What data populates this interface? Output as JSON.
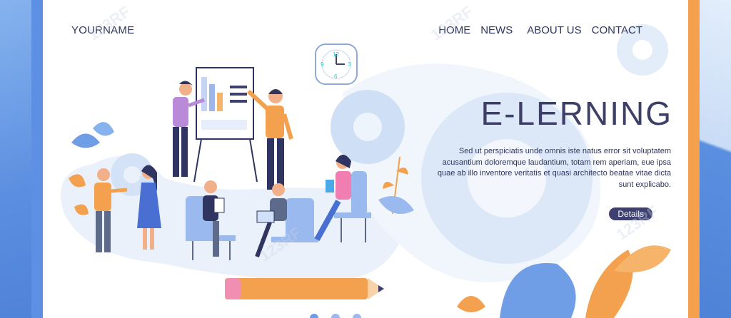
{
  "header": {
    "brand": "YOURNAME",
    "nav": [
      {
        "label": "HOME"
      },
      {
        "label": "NEWS"
      },
      {
        "label": "ABOUT US"
      },
      {
        "label": "CONTACT"
      }
    ]
  },
  "hero": {
    "title": "E-LERNING",
    "description": "Sed ut perspiciatis unde omnis iste natus error sit voluptatem acusantium doloremque laudantium, totam rem aperiam, eue ipsa quae ab illo inventore veritatis et quasi architecto beatae vitae dicta sunt explicabo.",
    "button_label": "Details"
  },
  "watermark_text": "123RF",
  "colors": {
    "accent_blue": "#5d90e2",
    "accent_orange": "#f4a04d",
    "navy": "#3e4170",
    "text": "#2e3560"
  }
}
